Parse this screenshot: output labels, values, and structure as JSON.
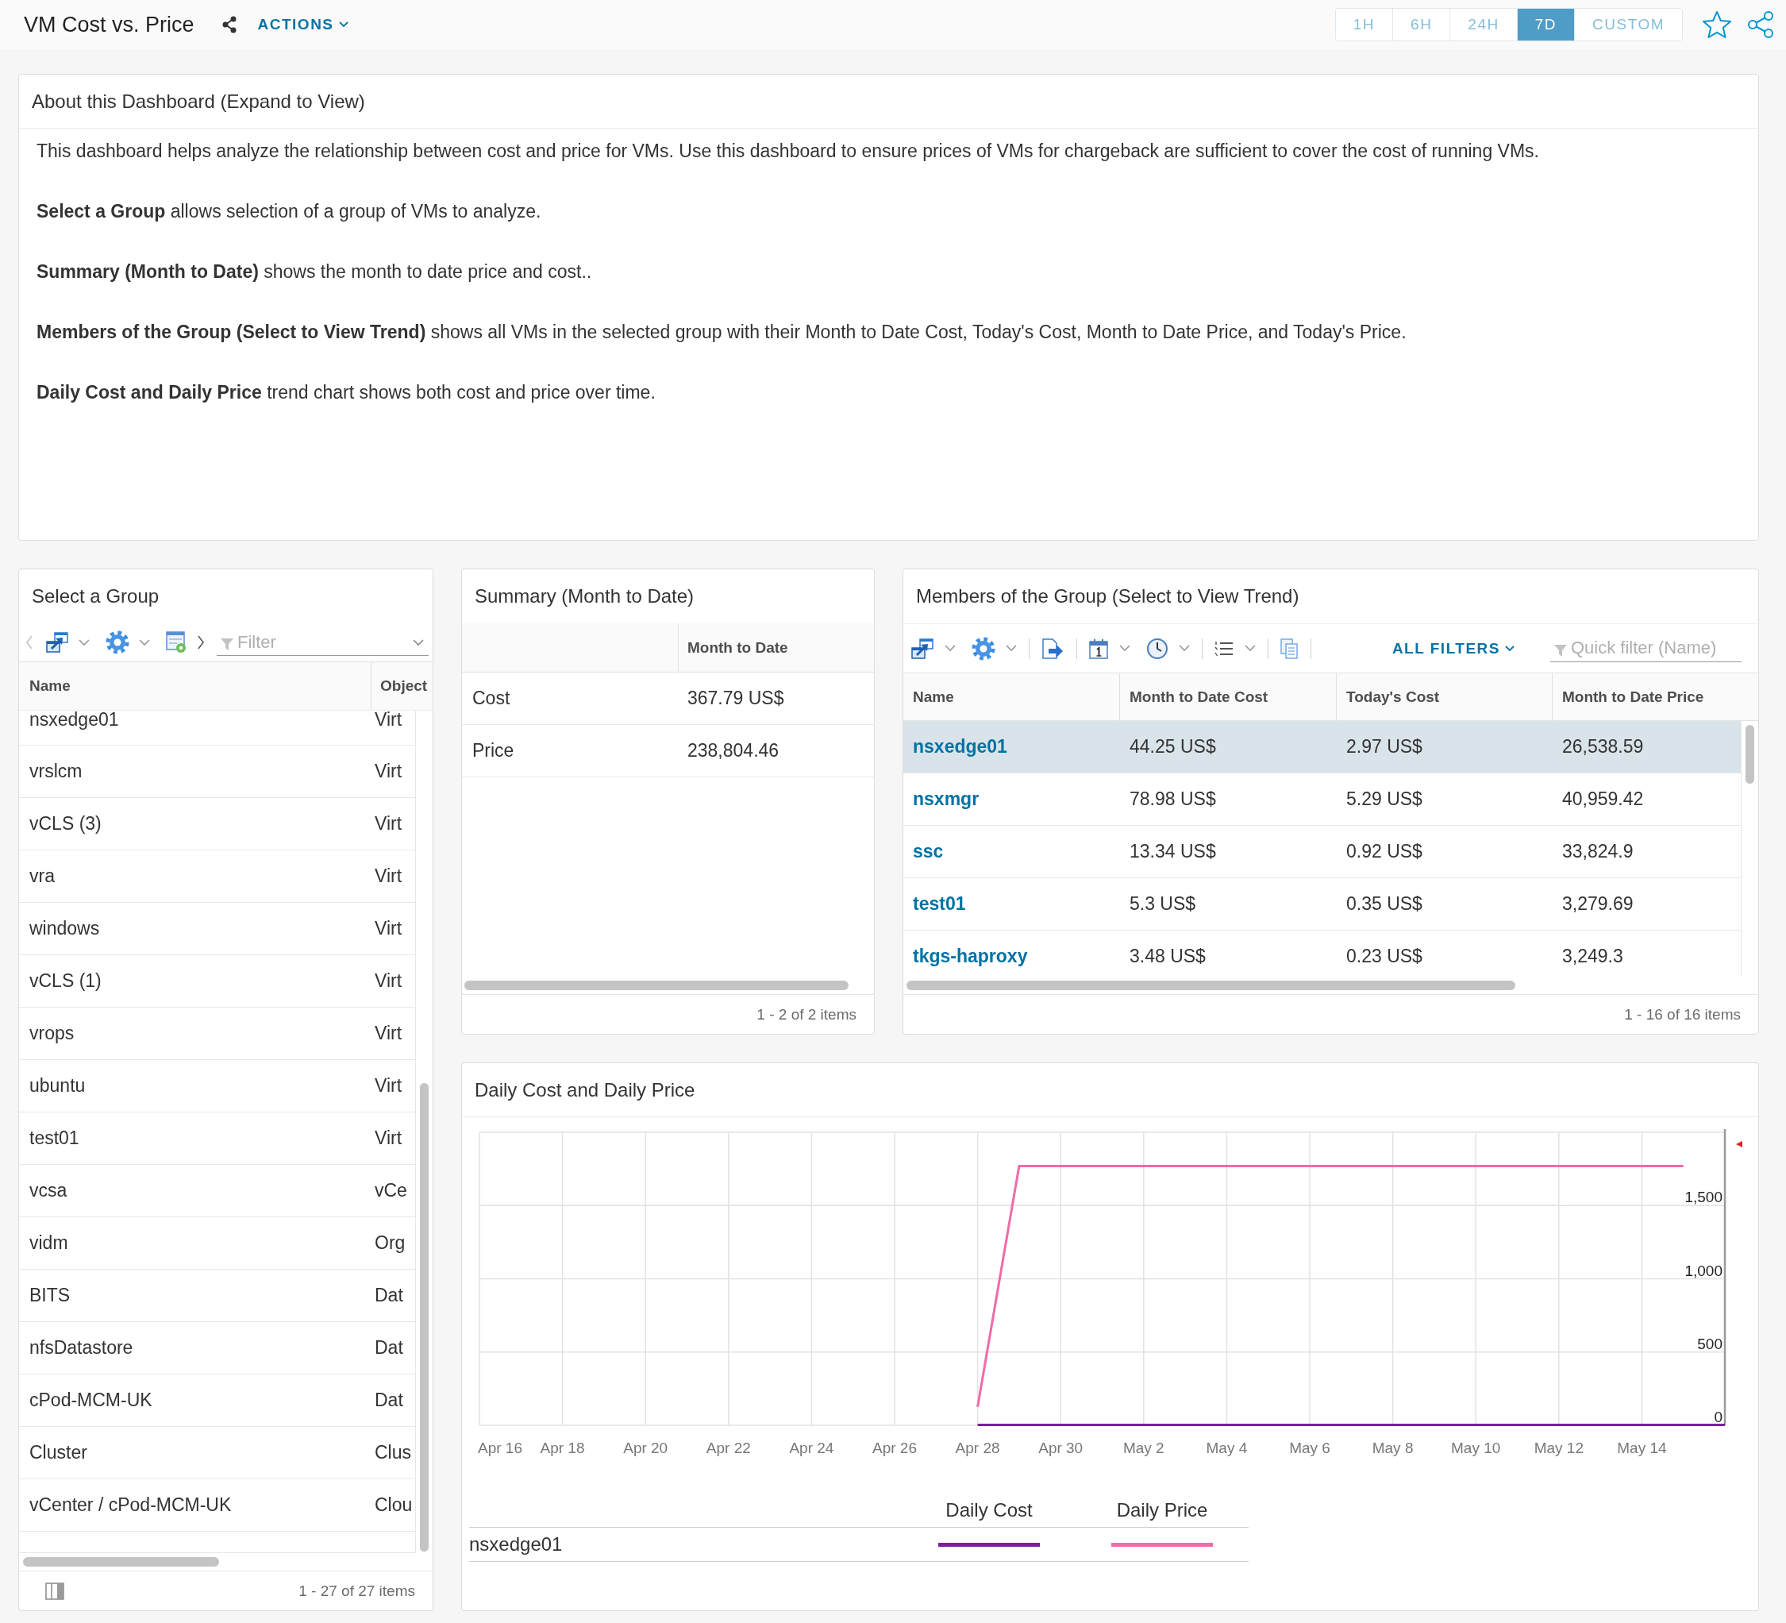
{
  "header": {
    "title": "VM Cost vs. Price",
    "actions_label": "ACTIONS",
    "time_ranges": [
      {
        "label": "1H",
        "selected": false
      },
      {
        "label": "6H",
        "selected": false
      },
      {
        "label": "24H",
        "selected": false
      },
      {
        "label": "7D",
        "selected": true
      },
      {
        "label": "CUSTOM",
        "selected": false
      }
    ]
  },
  "about": {
    "title": "About this Dashboard (Expand to View)",
    "paragraphs": [
      "This dashboard helps analyze the relationship between cost and price for VMs. Use this dashboard to ensure prices of VMs for chargeback are sufficient to cover the cost of running VMs.",
      "**Select a Group** allows selection of a group of VMs to analyze.",
      "**Summary (Month to Date)** shows the month to date price and cost..",
      "**Members of the Group (Select to View Trend)** shows all VMs in the selected group with their Month to Date Cost, Today's Cost, Month to Date Price, and Today's Price.",
      "**Daily Cost and Daily Price** trend chart shows both cost and price over time."
    ]
  },
  "select_group": {
    "title": "Select a Group",
    "filter_placeholder": "Filter",
    "columns": [
      "Name",
      "Object"
    ],
    "rows": [
      {
        "name": "nsxedge01",
        "object": "Virt",
        "selected": false
      },
      {
        "name": "vrslcm",
        "object": "Virt",
        "selected": false
      },
      {
        "name": "vCLS (3)",
        "object": "Virt",
        "selected": false
      },
      {
        "name": "vra",
        "object": "Virt",
        "selected": false
      },
      {
        "name": "windows",
        "object": "Virt",
        "selected": false
      },
      {
        "name": "vCLS (1)",
        "object": "Virt",
        "selected": false
      },
      {
        "name": "vrops",
        "object": "Virt",
        "selected": false
      },
      {
        "name": "ubuntu",
        "object": "Virt",
        "selected": false
      },
      {
        "name": "test01",
        "object": "Virt",
        "selected": false
      },
      {
        "name": "vcsa",
        "object": "vCe",
        "selected": false
      },
      {
        "name": "vidm",
        "object": "Org",
        "selected": false
      },
      {
        "name": "BITS",
        "object": "Dat",
        "selected": false
      },
      {
        "name": "nfsDatastore",
        "object": "Dat",
        "selected": false
      },
      {
        "name": "cPod-MCM-UK",
        "object": "Dat",
        "selected": false
      },
      {
        "name": "Cluster",
        "object": "Clus",
        "selected": false
      },
      {
        "name": "vCenter / cPod-MCM-UK",
        "object": "Clou",
        "selected": false
      }
    ],
    "footer": "1 - 27 of 27 items"
  },
  "summary": {
    "title": "Summary (Month to Date)",
    "columns": [
      "Month to Date"
    ],
    "rows": [
      {
        "label": "Cost",
        "value": "367.79 US$"
      },
      {
        "label": "Price",
        "value": "238,804.46"
      }
    ],
    "footer": "1 - 2 of 2 items"
  },
  "members": {
    "title": "Members of the Group (Select to View Trend)",
    "all_filters_label": "ALL FILTERS",
    "quick_filter_placeholder": "Quick filter (Name)",
    "columns": [
      "Name",
      "Month to Date Cost",
      "Today's Cost",
      "Month to Date Price"
    ],
    "rows": [
      {
        "cells": [
          "nsxedge01",
          "44.25 US$",
          "2.97 US$",
          "26,538.59"
        ],
        "selected": true
      },
      {
        "cells": [
          "nsxmgr",
          "78.98 US$",
          "5.29 US$",
          "40,959.42"
        ],
        "selected": false
      },
      {
        "cells": [
          "ssc",
          "13.34 US$",
          "0.92 US$",
          "33,824.9"
        ],
        "selected": false
      },
      {
        "cells": [
          "test01",
          "5.3 US$",
          "0.35 US$",
          "3,279.69"
        ],
        "selected": false
      },
      {
        "cells": [
          "tkgs-haproxy",
          "3.48 US$",
          "0.23 US$",
          "3,249.3"
        ],
        "selected": false
      }
    ],
    "footer": "1 - 16 of 16 items"
  },
  "trend": {
    "title": "Daily Cost and Daily Price",
    "chart_data": {
      "type": "line",
      "grid": true,
      "categories": [
        "Apr 16",
        null,
        "Apr 18",
        null,
        "Apr 20",
        null,
        "Apr 22",
        null,
        "Apr 24",
        null,
        "Apr 26",
        null,
        "Apr 28",
        null,
        "Apr 30",
        null,
        "May 2",
        null,
        "May 4",
        null,
        "May 6",
        null,
        "May 8",
        null,
        "May 10",
        null,
        "May 12",
        null,
        "May 14",
        null,
        null
      ],
      "series": [
        {
          "name": "Daily Cost",
          "color": "#7b1fa2",
          "values": [
            null,
            null,
            null,
            null,
            null,
            null,
            null,
            null,
            null,
            null,
            null,
            null,
            3,
            3,
            3,
            3,
            3,
            3,
            3,
            3,
            3,
            3,
            3,
            3,
            3,
            3,
            3,
            3,
            3,
            3,
            3
          ]
        },
        {
          "name": "Daily Price",
          "color": "#f06ba8",
          "values": [
            null,
            null,
            null,
            null,
            null,
            null,
            null,
            null,
            null,
            null,
            null,
            null,
            126,
            1770,
            1770,
            1770,
            1770,
            1770,
            1770,
            1770,
            1770,
            1770,
            1770,
            1770,
            1770,
            1770,
            1770,
            1770,
            1770,
            1770,
            null
          ]
        }
      ],
      "ylim": [
        0,
        2000
      ],
      "yticks": [
        {
          "value": 0,
          "label": "0"
        },
        {
          "value": 500,
          "label": "500"
        },
        {
          "value": 1000,
          "label": "1,000"
        },
        {
          "value": 1500,
          "label": "1,500"
        }
      ]
    },
    "legend_row_label": "nsxedge01"
  }
}
